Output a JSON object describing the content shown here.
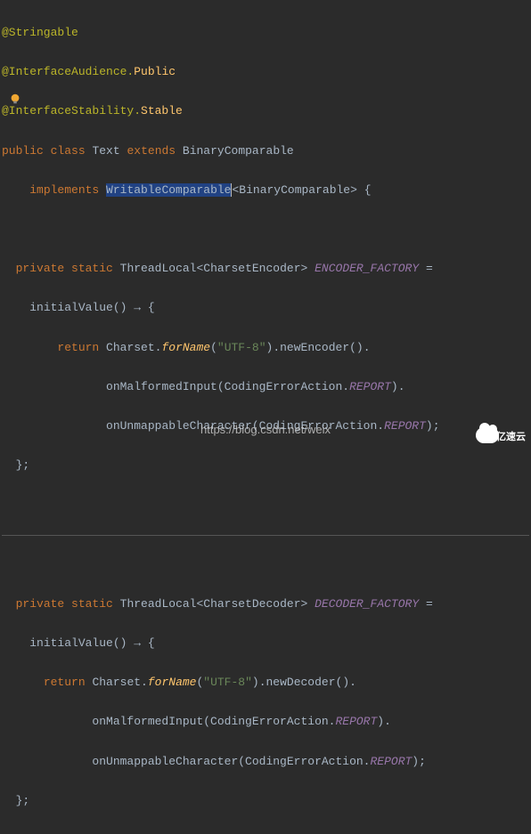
{
  "code": {
    "annotations": {
      "stringable": "@Stringable",
      "audience_prefix": "@InterfaceAudience.",
      "audience_value": "Public",
      "stability_prefix": "@InterfaceStability.",
      "stability_value": "Stable"
    },
    "decl": {
      "public": "public",
      "class": "class",
      "name": "Text",
      "extends": "extends",
      "super": "BinaryComparable",
      "implements": "implements",
      "impl_selected": "WritableComparable",
      "impl_generic_open": "<BinaryComparable> {"
    },
    "enc": {
      "private": "private",
      "static": "static",
      "type": "ThreadLocal<CharsetEncoder>",
      "name": "ENCODER_FACTORY",
      "assign": "=",
      "init_lhs": "initialValue",
      "lambda": "() → {",
      "return": "return",
      "charset": "Charset.",
      "forname": "forName",
      "utf8": "\"UTF-8\"",
      "newenc": ".newEncoder().",
      "malformed": "onMalformedInput(CodingErrorAction.",
      "report1": "REPORT",
      "after_report1": ").",
      "unmap": "onUnmappableCharacter(CodingErrorAction.",
      "report2": "REPORT",
      "after_report2": ");",
      "close": "};"
    },
    "dec": {
      "private": "private",
      "static": "static",
      "type": "ThreadLocal<CharsetDecoder>",
      "name": "DECODER_FACTORY",
      "assign": "=",
      "init_lhs": "initialValue",
      "lambda": "() → {",
      "return": "return",
      "charset": "Charset.",
      "forname": "forName",
      "utf8": "\"UTF-8\"",
      "newdec": ".newDecoder().",
      "malformed": "onMalformedInput(CodingErrorAction.",
      "report1": "REPORT",
      "after_report1": ").",
      "unmap": "onUnmappableCharacter(CodingErrorAction.",
      "report2": "REPORT",
      "after_report2": ");",
      "close": "};"
    }
  },
  "watermark": "https://blog.csdn.net/weix",
  "logo_text": "亿速云"
}
